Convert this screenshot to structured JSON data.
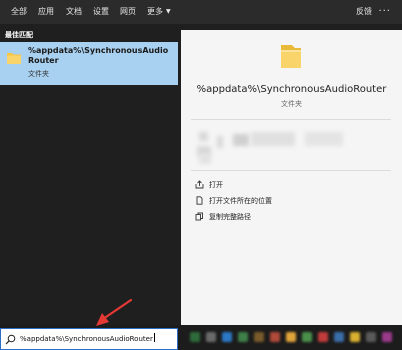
{
  "nav": {
    "tabs": [
      "全部",
      "应用",
      "文档",
      "设置",
      "网页",
      "更多"
    ],
    "feedback_label": "反馈",
    "more_icon": "ellipsis-icon"
  },
  "results": {
    "section_title": "最佳匹配",
    "best_match": {
      "name": "%appdata%\\SynchronousAudioRouter",
      "type": "文件夹"
    }
  },
  "preview": {
    "title": "%appdata%\\SynchronousAudioRouter",
    "subtitle": "文件夹",
    "actions": [
      {
        "label": "打开",
        "icon": "open-folder-icon"
      },
      {
        "label": "打开文件所在的位置",
        "icon": "file-location-icon"
      },
      {
        "label": "复制完整路径",
        "icon": "copy-icon"
      }
    ]
  },
  "search": {
    "value": "%appdata%\\SynchronousAudioRouter"
  },
  "colors": {
    "selected_result": "#a8d0f0",
    "arrow": "#e53935",
    "folder": "#f5c542"
  }
}
